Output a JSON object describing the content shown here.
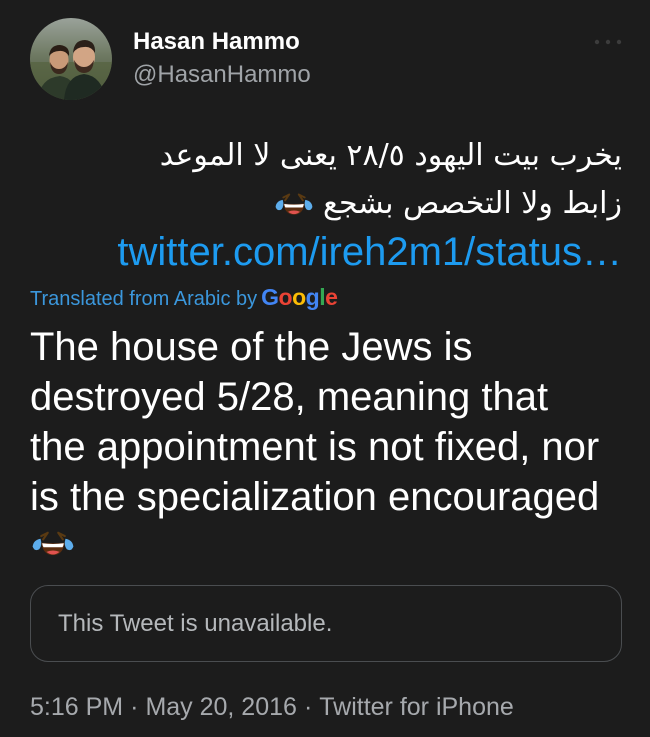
{
  "colors": {
    "background": "#1c1c1c",
    "text": "#ffffff",
    "secondary_text": "#a0a4a8",
    "link": "#1d9bf0",
    "translation_label": "#3b97dc",
    "border": "#4a4d50",
    "google": [
      "#4285F4",
      "#EA4335",
      "#FBBC05",
      "#4285F4",
      "#34A853",
      "#EA4335"
    ]
  },
  "icons": {
    "more": "more-icon",
    "emoji": "face-with-tears-of-joy-icon",
    "avatar": "avatar"
  },
  "author": {
    "name": "Hasan Hammo",
    "handle": "@HasanHammo"
  },
  "tweet": {
    "original_lines": [
      "يخرب بيت اليهود ٢٨/٥ يعنى لا الموعد",
      "زابط ولا التخصص بشجع"
    ],
    "link": "twitter.com/ireh2m1/status…",
    "translation_label": "Translated from Arabic by",
    "translation_provider": "Google",
    "translation_lines": [
      "The house of the Jews is",
      "destroyed 5/28, meaning that",
      "the appointment is not fixed, nor",
      "is the specialization encouraged"
    ]
  },
  "quoted_tweet": {
    "text": "This Tweet is unavailable."
  },
  "footer": {
    "time": "5:16 PM",
    "separator": "·",
    "date": "May 20, 2016",
    "source": "Twitter for iPhone"
  }
}
